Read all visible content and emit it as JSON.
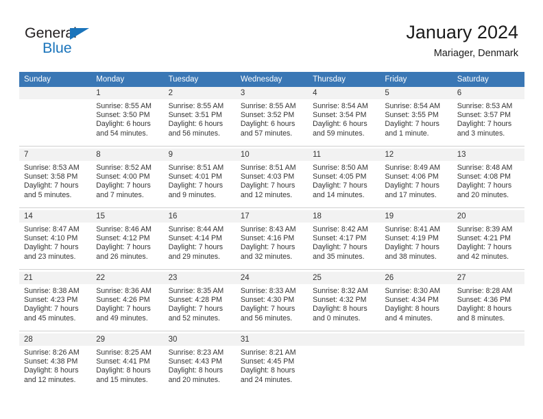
{
  "brand": {
    "word_one": "General",
    "word_two": "Blue",
    "triangle_color": "#1a74bb",
    "text_color": "#231f20"
  },
  "header": {
    "title": "January 2024",
    "subtitle": "Mariager, Denmark"
  },
  "calendar": {
    "header_bg": "#3a77b5",
    "daynum_bg": "#f2f2f2",
    "weekdays": [
      "Sunday",
      "Monday",
      "Tuesday",
      "Wednesday",
      "Thursday",
      "Friday",
      "Saturday"
    ],
    "weeks": [
      [
        {
          "day": ""
        },
        {
          "day": "1",
          "sunrise": "Sunrise: 8:55 AM",
          "sunset": "Sunset: 3:50 PM",
          "daylight1": "Daylight: 6 hours",
          "daylight2": "and 54 minutes."
        },
        {
          "day": "2",
          "sunrise": "Sunrise: 8:55 AM",
          "sunset": "Sunset: 3:51 PM",
          "daylight1": "Daylight: 6 hours",
          "daylight2": "and 56 minutes."
        },
        {
          "day": "3",
          "sunrise": "Sunrise: 8:55 AM",
          "sunset": "Sunset: 3:52 PM",
          "daylight1": "Daylight: 6 hours",
          "daylight2": "and 57 minutes."
        },
        {
          "day": "4",
          "sunrise": "Sunrise: 8:54 AM",
          "sunset": "Sunset: 3:54 PM",
          "daylight1": "Daylight: 6 hours",
          "daylight2": "and 59 minutes."
        },
        {
          "day": "5",
          "sunrise": "Sunrise: 8:54 AM",
          "sunset": "Sunset: 3:55 PM",
          "daylight1": "Daylight: 7 hours",
          "daylight2": "and 1 minute."
        },
        {
          "day": "6",
          "sunrise": "Sunrise: 8:53 AM",
          "sunset": "Sunset: 3:57 PM",
          "daylight1": "Daylight: 7 hours",
          "daylight2": "and 3 minutes."
        }
      ],
      [
        {
          "day": "7",
          "sunrise": "Sunrise: 8:53 AM",
          "sunset": "Sunset: 3:58 PM",
          "daylight1": "Daylight: 7 hours",
          "daylight2": "and 5 minutes."
        },
        {
          "day": "8",
          "sunrise": "Sunrise: 8:52 AM",
          "sunset": "Sunset: 4:00 PM",
          "daylight1": "Daylight: 7 hours",
          "daylight2": "and 7 minutes."
        },
        {
          "day": "9",
          "sunrise": "Sunrise: 8:51 AM",
          "sunset": "Sunset: 4:01 PM",
          "daylight1": "Daylight: 7 hours",
          "daylight2": "and 9 minutes."
        },
        {
          "day": "10",
          "sunrise": "Sunrise: 8:51 AM",
          "sunset": "Sunset: 4:03 PM",
          "daylight1": "Daylight: 7 hours",
          "daylight2": "and 12 minutes."
        },
        {
          "day": "11",
          "sunrise": "Sunrise: 8:50 AM",
          "sunset": "Sunset: 4:05 PM",
          "daylight1": "Daylight: 7 hours",
          "daylight2": "and 14 minutes."
        },
        {
          "day": "12",
          "sunrise": "Sunrise: 8:49 AM",
          "sunset": "Sunset: 4:06 PM",
          "daylight1": "Daylight: 7 hours",
          "daylight2": "and 17 minutes."
        },
        {
          "day": "13",
          "sunrise": "Sunrise: 8:48 AM",
          "sunset": "Sunset: 4:08 PM",
          "daylight1": "Daylight: 7 hours",
          "daylight2": "and 20 minutes."
        }
      ],
      [
        {
          "day": "14",
          "sunrise": "Sunrise: 8:47 AM",
          "sunset": "Sunset: 4:10 PM",
          "daylight1": "Daylight: 7 hours",
          "daylight2": "and 23 minutes."
        },
        {
          "day": "15",
          "sunrise": "Sunrise: 8:46 AM",
          "sunset": "Sunset: 4:12 PM",
          "daylight1": "Daylight: 7 hours",
          "daylight2": "and 26 minutes."
        },
        {
          "day": "16",
          "sunrise": "Sunrise: 8:44 AM",
          "sunset": "Sunset: 4:14 PM",
          "daylight1": "Daylight: 7 hours",
          "daylight2": "and 29 minutes."
        },
        {
          "day": "17",
          "sunrise": "Sunrise: 8:43 AM",
          "sunset": "Sunset: 4:16 PM",
          "daylight1": "Daylight: 7 hours",
          "daylight2": "and 32 minutes."
        },
        {
          "day": "18",
          "sunrise": "Sunrise: 8:42 AM",
          "sunset": "Sunset: 4:17 PM",
          "daylight1": "Daylight: 7 hours",
          "daylight2": "and 35 minutes."
        },
        {
          "day": "19",
          "sunrise": "Sunrise: 8:41 AM",
          "sunset": "Sunset: 4:19 PM",
          "daylight1": "Daylight: 7 hours",
          "daylight2": "and 38 minutes."
        },
        {
          "day": "20",
          "sunrise": "Sunrise: 8:39 AM",
          "sunset": "Sunset: 4:21 PM",
          "daylight1": "Daylight: 7 hours",
          "daylight2": "and 42 minutes."
        }
      ],
      [
        {
          "day": "21",
          "sunrise": "Sunrise: 8:38 AM",
          "sunset": "Sunset: 4:23 PM",
          "daylight1": "Daylight: 7 hours",
          "daylight2": "and 45 minutes."
        },
        {
          "day": "22",
          "sunrise": "Sunrise: 8:36 AM",
          "sunset": "Sunset: 4:26 PM",
          "daylight1": "Daylight: 7 hours",
          "daylight2": "and 49 minutes."
        },
        {
          "day": "23",
          "sunrise": "Sunrise: 8:35 AM",
          "sunset": "Sunset: 4:28 PM",
          "daylight1": "Daylight: 7 hours",
          "daylight2": "and 52 minutes."
        },
        {
          "day": "24",
          "sunrise": "Sunrise: 8:33 AM",
          "sunset": "Sunset: 4:30 PM",
          "daylight1": "Daylight: 7 hours",
          "daylight2": "and 56 minutes."
        },
        {
          "day": "25",
          "sunrise": "Sunrise: 8:32 AM",
          "sunset": "Sunset: 4:32 PM",
          "daylight1": "Daylight: 8 hours",
          "daylight2": "and 0 minutes."
        },
        {
          "day": "26",
          "sunrise": "Sunrise: 8:30 AM",
          "sunset": "Sunset: 4:34 PM",
          "daylight1": "Daylight: 8 hours",
          "daylight2": "and 4 minutes."
        },
        {
          "day": "27",
          "sunrise": "Sunrise: 8:28 AM",
          "sunset": "Sunset: 4:36 PM",
          "daylight1": "Daylight: 8 hours",
          "daylight2": "and 8 minutes."
        }
      ],
      [
        {
          "day": "28",
          "sunrise": "Sunrise: 8:26 AM",
          "sunset": "Sunset: 4:38 PM",
          "daylight1": "Daylight: 8 hours",
          "daylight2": "and 12 minutes."
        },
        {
          "day": "29",
          "sunrise": "Sunrise: 8:25 AM",
          "sunset": "Sunset: 4:41 PM",
          "daylight1": "Daylight: 8 hours",
          "daylight2": "and 15 minutes."
        },
        {
          "day": "30",
          "sunrise": "Sunrise: 8:23 AM",
          "sunset": "Sunset: 4:43 PM",
          "daylight1": "Daylight: 8 hours",
          "daylight2": "and 20 minutes."
        },
        {
          "day": "31",
          "sunrise": "Sunrise: 8:21 AM",
          "sunset": "Sunset: 4:45 PM",
          "daylight1": "Daylight: 8 hours",
          "daylight2": "and 24 minutes."
        },
        {
          "day": ""
        },
        {
          "day": ""
        },
        {
          "day": ""
        }
      ]
    ]
  }
}
